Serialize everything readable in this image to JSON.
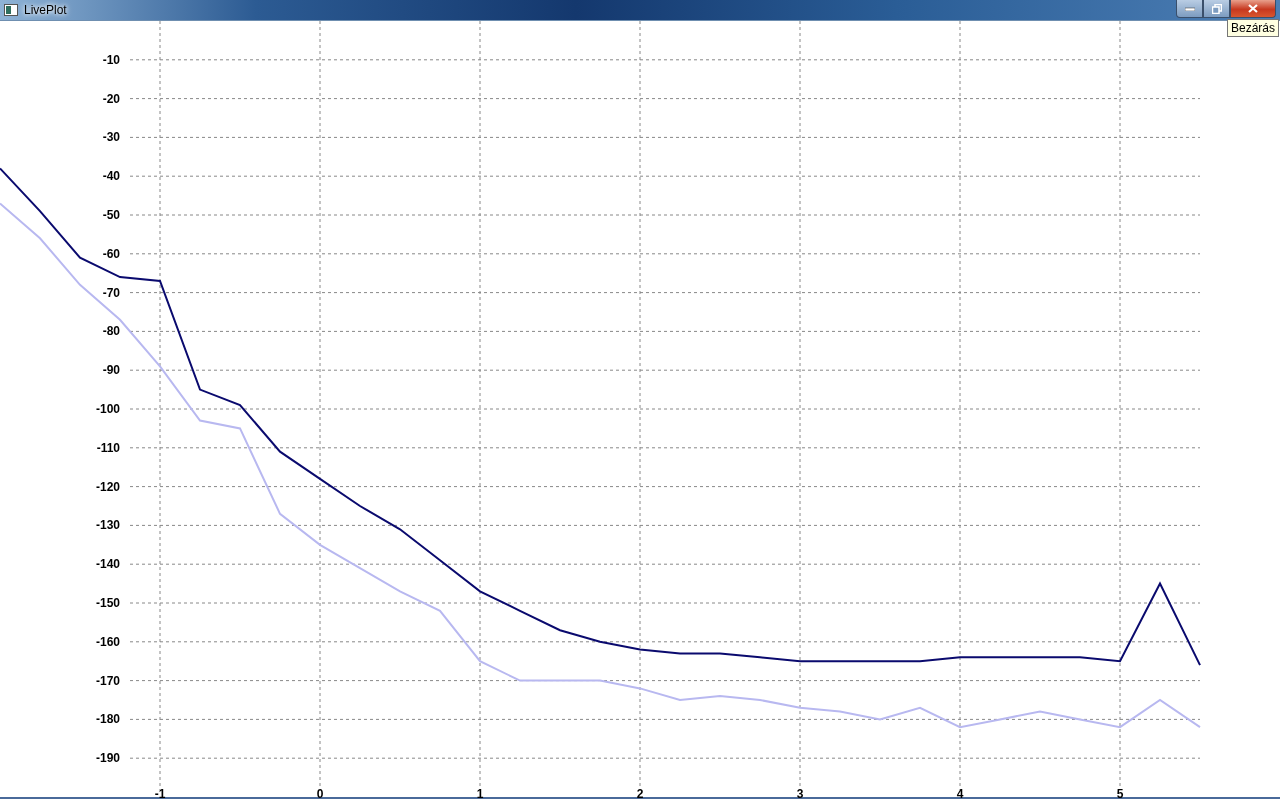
{
  "window": {
    "title": "LivePlot",
    "tooltip": "Bezárás"
  },
  "plot": {
    "chart_data": {
      "type": "line",
      "x": [
        -2,
        -1.75,
        -1.5,
        -1.25,
        -1,
        -0.75,
        -0.5,
        -0.25,
        0,
        0.25,
        0.5,
        0.75,
        1,
        1.25,
        1.5,
        1.75,
        2,
        2.25,
        2.5,
        2.75,
        3,
        3.25,
        3.5,
        3.75,
        4,
        4.25,
        4.5,
        4.75,
        5,
        5.25,
        5.5
      ],
      "series": [
        {
          "color": "#0a0a6e",
          "values": [
            -38,
            -49,
            -61,
            -66,
            -67,
            -95,
            -99,
            -111,
            -118,
            -125,
            -131,
            -139,
            -147,
            -152,
            -157,
            -160,
            -162,
            -163,
            -163,
            -164,
            -165,
            -165,
            -165,
            -165,
            -164,
            -164,
            -164,
            -164,
            -165,
            -145,
            -166
          ]
        },
        {
          "color": "#b8b8f0",
          "values": [
            -47,
            -56,
            -68,
            -77,
            -89,
            -103,
            -105,
            -127,
            -135,
            -141,
            -147,
            -152,
            -165,
            -170,
            -170,
            -170,
            -172,
            -175,
            -174,
            -175,
            -177,
            -178,
            -180,
            -177,
            -182,
            -180,
            -178,
            -180,
            -182,
            -175,
            -182
          ]
        }
      ],
      "grid": true,
      "xlim": [
        -2,
        6
      ],
      "ylim": [
        -200,
        0
      ],
      "xticks": [
        -1,
        0,
        1,
        2,
        3,
        4,
        5
      ],
      "yticks": [
        -10,
        -20,
        -30,
        -40,
        -50,
        -60,
        -70,
        -80,
        -90,
        -100,
        -110,
        -120,
        -130,
        -140,
        -150,
        -160,
        -170,
        -180,
        -190
      ]
    }
  }
}
